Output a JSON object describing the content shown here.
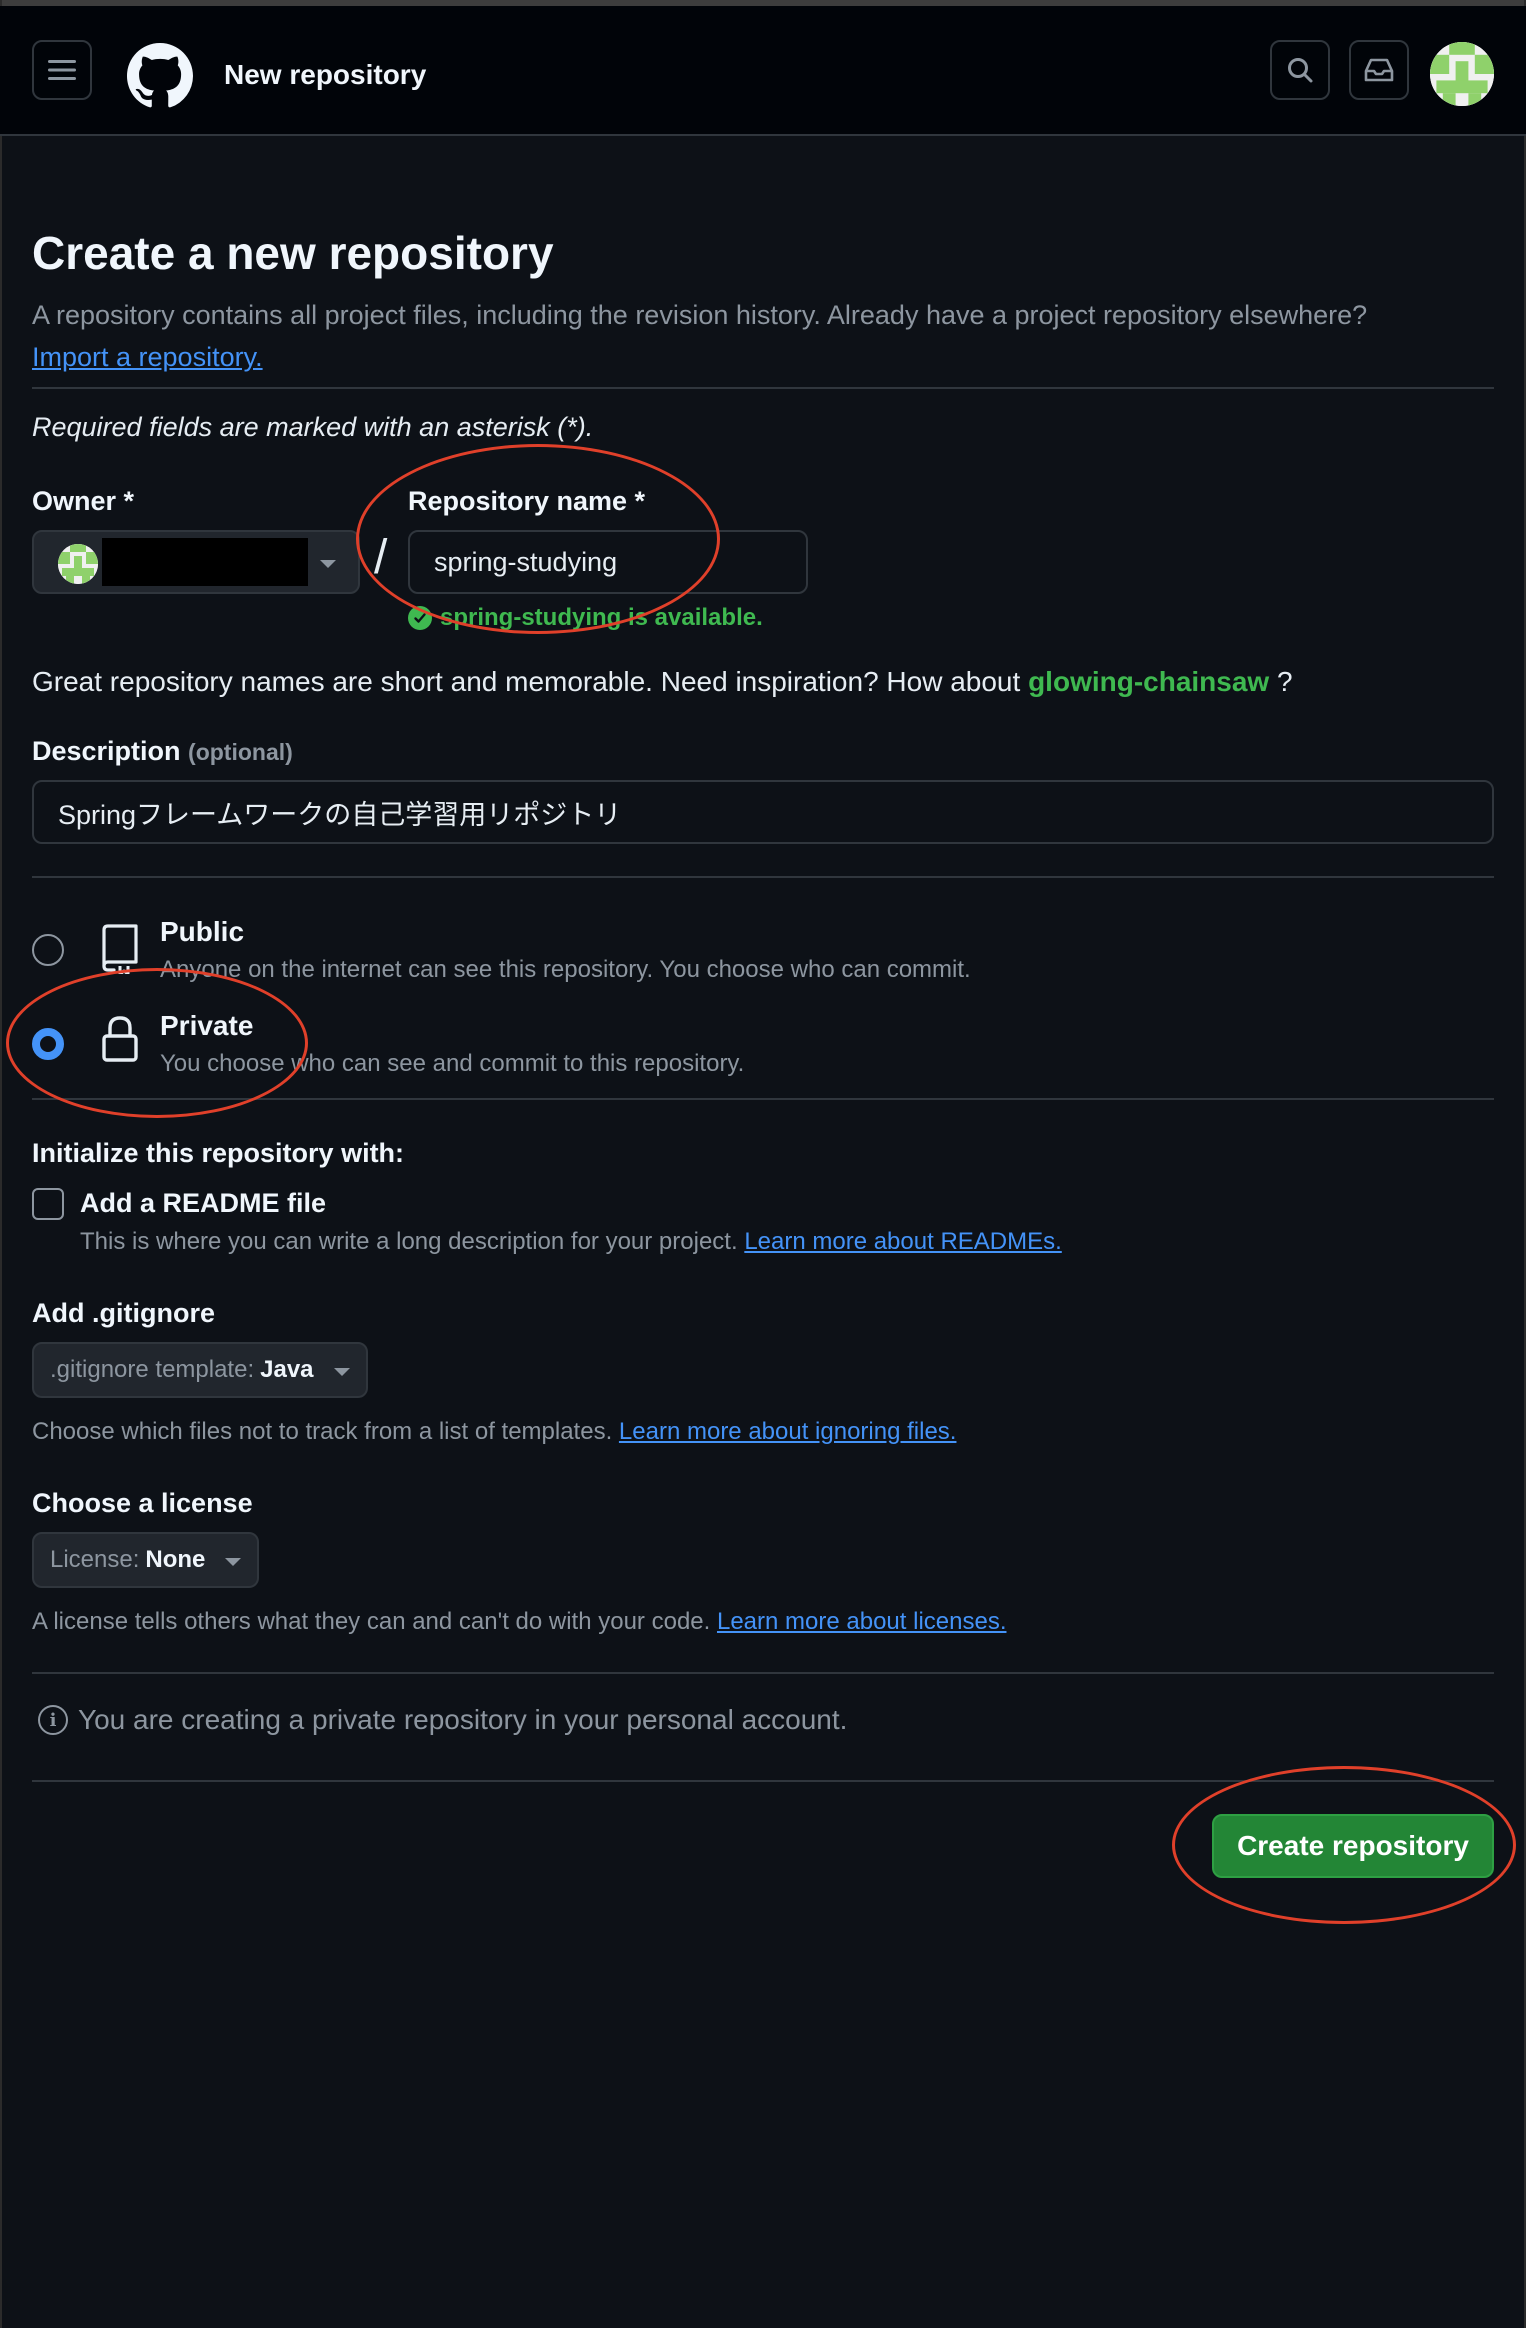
{
  "header": {
    "title": "New repository",
    "menu_icon": "hamburger-icon",
    "logo_icon": "github-logo-icon",
    "search_icon": "search-icon",
    "inbox_icon": "inbox-icon"
  },
  "page": {
    "heading": "Create a new repository",
    "subtitle": "A repository contains all project files, including the revision history. Already have a project repository elsewhere?",
    "import_link": "Import a repository.",
    "required_note": "Required fields are marked with an asterisk (*)."
  },
  "form": {
    "owner_label": "Owner *",
    "separator": "/",
    "repo_name_label": "Repository name *",
    "repo_name_value": "spring-studying",
    "availability": "spring-studying is available.",
    "inspiration_text": "Great repository names are short and memorable. Need inspiration? How about",
    "suggestion": "glowing-chainsaw",
    "suggestion_suffix": "?",
    "description_label": "Description",
    "description_optional": "(optional)",
    "description_value": "Springフレームワークの自己学習用リポジトリ"
  },
  "visibility": {
    "public_title": "Public",
    "public_desc": "Anyone on the internet can see this repository. You choose who can commit.",
    "private_title": "Private",
    "private_desc": "You choose who can see and commit to this repository.",
    "selected": "private"
  },
  "initialize": {
    "heading": "Initialize this repository with:",
    "readme_label": "Add a README file",
    "readme_desc": "This is where you can write a long description for your project.",
    "readme_link": "Learn more about READMEs.",
    "readme_checked": false,
    "gitignore_label": "Add .gitignore",
    "gitignore_prefix": ".gitignore template:",
    "gitignore_value": "Java",
    "gitignore_desc": "Choose which files not to track from a list of templates.",
    "gitignore_link": "Learn more about ignoring files.",
    "license_label": "Choose a license",
    "license_prefix": "License:",
    "license_value": "None",
    "license_desc": "A license tells others what they can and can't do with your code.",
    "license_link": "Learn more about licenses."
  },
  "footer": {
    "info_note": "You are creating a private repository in your personal account.",
    "create_button": "Create repository"
  },
  "colors": {
    "background": "#0d1117",
    "header_bg": "#010409",
    "accent_link": "#4493f8",
    "success_green": "#3fb950",
    "button_green": "#238636",
    "annotation_red": "#e0402a"
  }
}
